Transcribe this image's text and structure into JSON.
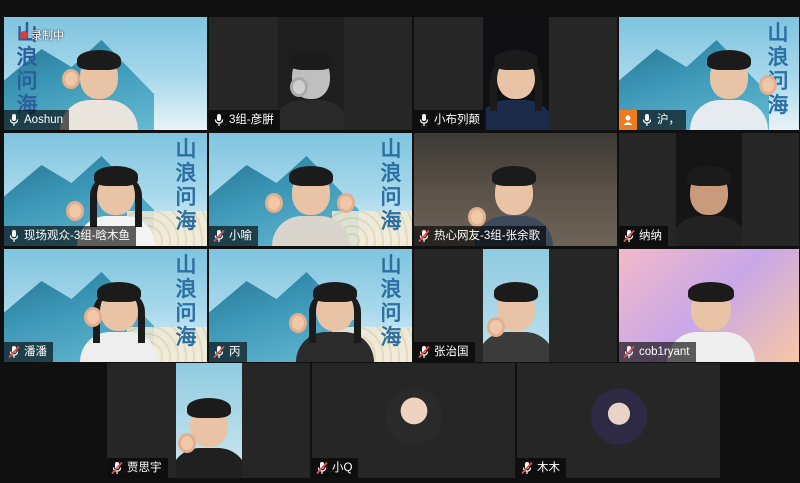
{
  "recording": {
    "text": "录制中"
  },
  "poster": {
    "title": "山浪问海",
    "title_partial": "浪问"
  },
  "tiles": [
    {
      "name": "Aoshun",
      "mic": "on"
    },
    {
      "name": "3组-彦腁",
      "mic": "on"
    },
    {
      "name": "小布列颠",
      "mic": "on"
    },
    {
      "name": "沪，",
      "mic": "on",
      "host": true
    },
    {
      "name": "现场观众-3组-晗木鱼",
      "mic": "on"
    },
    {
      "name": "小喻",
      "mic": "muted"
    },
    {
      "name": "热心网友-3组-张余歌",
      "mic": "muted"
    },
    {
      "name": "纳纳",
      "mic": "muted"
    },
    {
      "name": "潘潘",
      "mic": "muted"
    },
    {
      "name": "丙",
      "mic": "muted"
    },
    {
      "name": "张治国",
      "mic": "muted"
    },
    {
      "name": "cob1ryant",
      "mic": "muted"
    },
    {
      "name": "贾思宇",
      "mic": "muted"
    },
    {
      "name": "小Q",
      "mic": "muted"
    },
    {
      "name": "木木",
      "mic": "muted"
    }
  ],
  "colors": {
    "muted_mic": "#e0504f",
    "live_mic": "#ffffff",
    "host_badge": "#f07b1a"
  }
}
